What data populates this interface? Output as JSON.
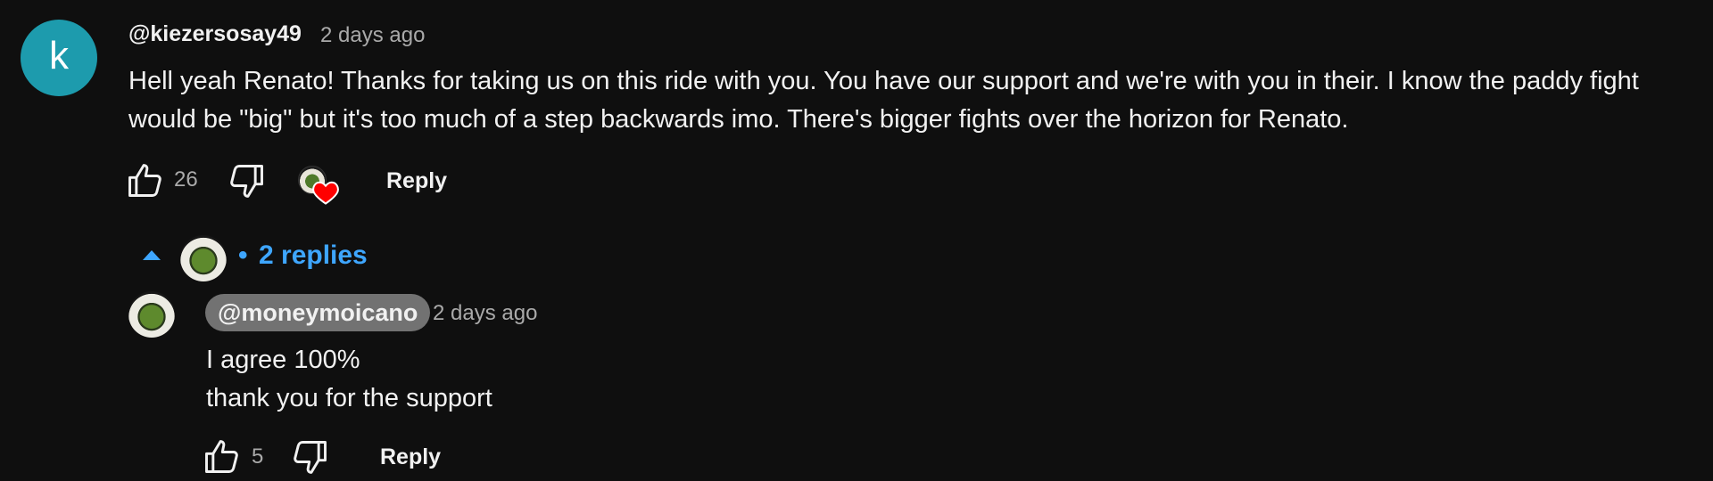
{
  "comment": {
    "avatar_letter": "k",
    "author": "@kiezersosay49",
    "time": "2 days ago",
    "text_lines": [
      "Hell yeah Renato! Thanks for taking us on this ride with you. You have our support and we're with you in their. I know the paddy fight",
      "would be \"big\" but it's too much of a step backwards imo. There's bigger fights over the horizon for Renato."
    ],
    "like_count": "26",
    "reply_label": "Reply",
    "creator_heart": true
  },
  "replies_toggle": {
    "separator": "•",
    "label": "2 replies",
    "icon": "caret-up-icon"
  },
  "reply": {
    "author": "@moneymoicano",
    "time": "2 days ago",
    "text_lines": [
      "I agree 100%",
      "thank you for the support"
    ],
    "like_count": "5",
    "reply_label": "Reply"
  },
  "colors": {
    "background": "#0f0f0f",
    "text": "#f1f1f1",
    "secondary_text": "#aaaaaa",
    "link_blue": "#3ea6ff",
    "avatar_teal": "#1d9bad",
    "heart_red": "#ff0000",
    "channel_badge": "#727272"
  }
}
